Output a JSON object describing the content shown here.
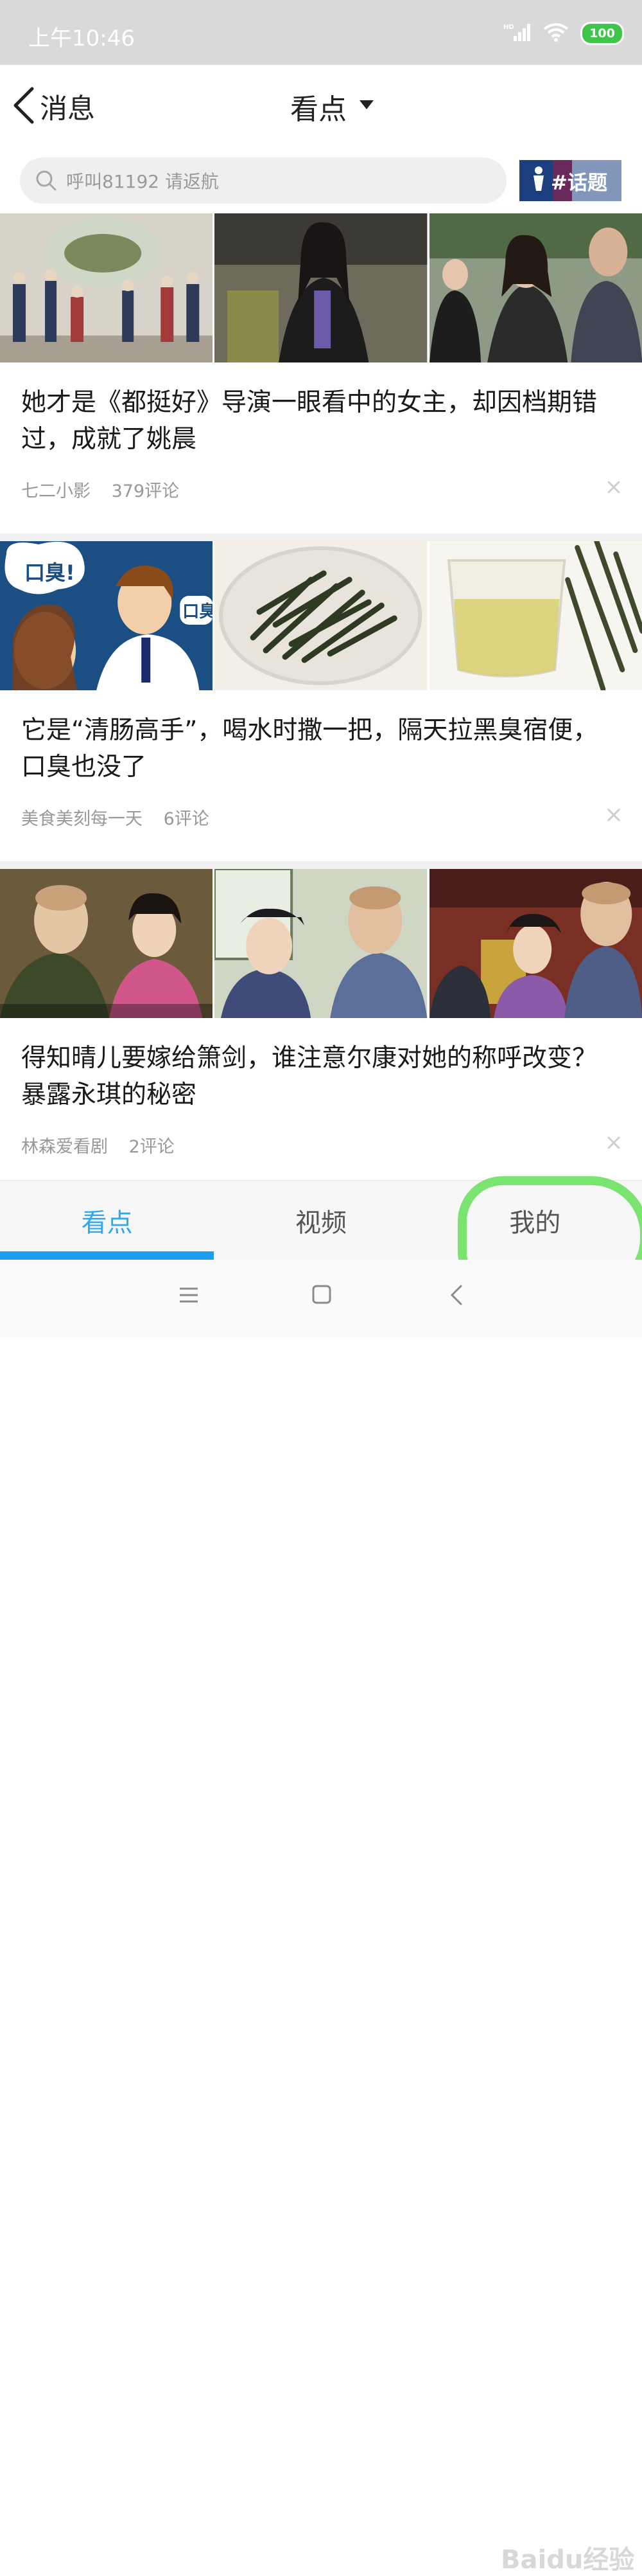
{
  "status": {
    "time": "上午10:46",
    "battery": "100"
  },
  "nav": {
    "back_label": "消息",
    "title": "看点"
  },
  "search": {
    "placeholder": "呼叫81192 请返航",
    "topic_label": "#话题"
  },
  "feed": [
    {
      "title": "她才是《都挺好》导演一眼看中的女主，却因档期错过，成就了姚晨",
      "source": "七二小影",
      "comments": "379评论"
    },
    {
      "title": "它是“清肠高手”，喝水时撒一把，隔天拉黑臭宿便，口臭也没了",
      "source": "美食美刻每一天",
      "comments": "6评论"
    },
    {
      "title": "得知晴儿要嫁给箫剑，谁注意尔康对她的称呼改变？暴露永琪的秘密",
      "source": "林森爱看剧",
      "comments": "2评论"
    }
  ],
  "tabs": [
    {
      "label": "看点",
      "active": true
    },
    {
      "label": "视频",
      "active": false
    },
    {
      "label": "我的",
      "active": false
    }
  ],
  "watermark": "Baidu经验",
  "colors": {
    "accent": "#1e9ef0",
    "highlight_ring": "#7be36f",
    "battery": "#3ec54a",
    "nba_badge": "#1b3f7f"
  }
}
